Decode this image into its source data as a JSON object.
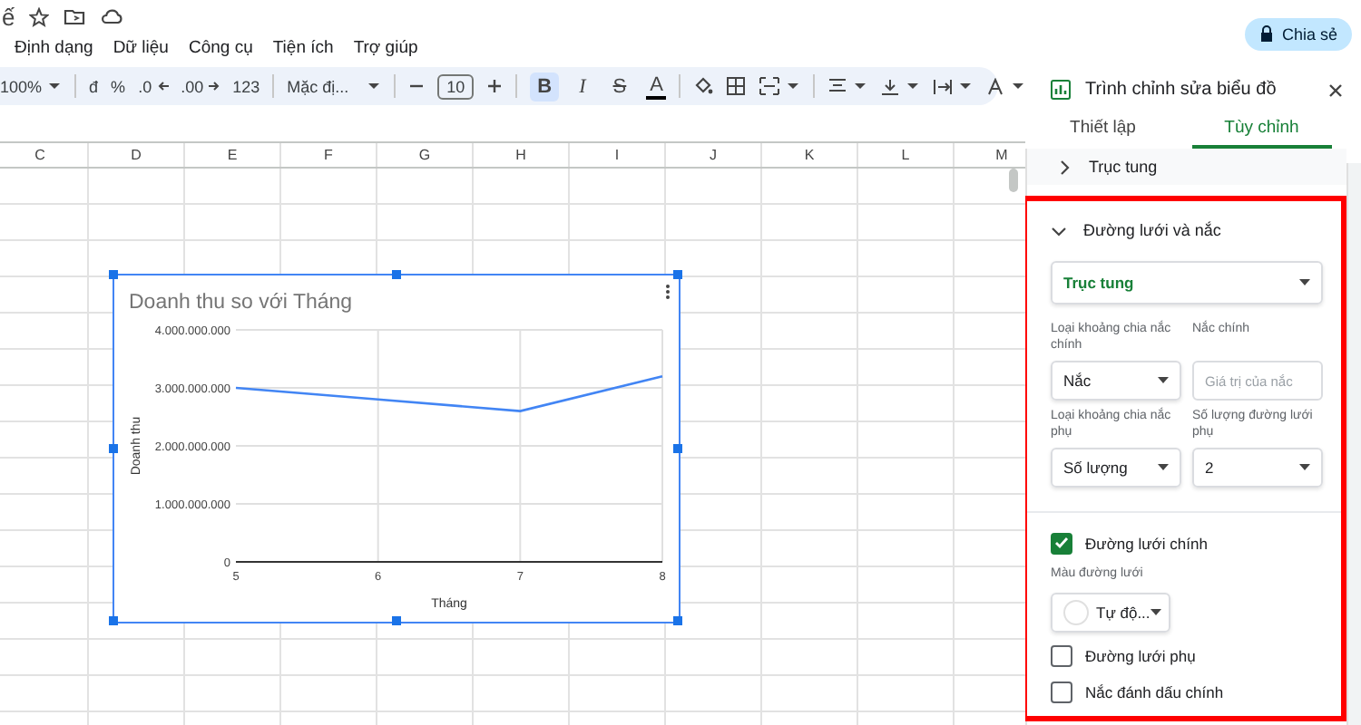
{
  "document": {
    "title_fragment": "ế"
  },
  "menu": [
    "Định dạng",
    "Dữ liệu",
    "Công cụ",
    "Tiện ích",
    "Trợ giúp"
  ],
  "share_button": "Chia sẻ",
  "toolbar": {
    "zoom": "100%",
    "currency": "đ",
    "percent": "%",
    "decrease_decimal": ".0",
    "increase_decimal": ".00",
    "number_format": "123",
    "font": "Mặc đị...",
    "font_size": "10",
    "format_buttons": [
      {
        "kind": "bold",
        "label": "B",
        "selected": true
      },
      {
        "kind": "italic",
        "label": "I",
        "selected": false
      },
      {
        "kind": "strike",
        "label": "S",
        "selected": false
      },
      {
        "kind": "color",
        "label": "A",
        "selected": false
      }
    ]
  },
  "columns": [
    "C",
    "D",
    "E",
    "F",
    "G",
    "H",
    "I",
    "J",
    "K",
    "L",
    "M"
  ],
  "chart": {
    "chart_data": {
      "type": "line",
      "title": "Doanh thu so với Tháng",
      "xlabel": "Tháng",
      "ylabel": "Doanh thu",
      "x": [
        5,
        6,
        7,
        8
      ],
      "series": [
        {
          "color": "#4285f4",
          "values": [
            3000000000,
            2800000000,
            2600000000,
            3200000000
          ]
        }
      ],
      "grid": true,
      "xlim": [
        5,
        8
      ],
      "ylim": [
        0,
        4000000000
      ],
      "xticks": [
        5,
        6,
        7,
        8
      ],
      "yticks": [
        {
          "value": 0,
          "label": "0"
        },
        {
          "value": 1000000000,
          "label": "1.000.000.000"
        },
        {
          "value": 2000000000,
          "label": "2.000.000.000"
        },
        {
          "value": 3000000000,
          "label": "3.000.000.000"
        },
        {
          "value": 4000000000,
          "label": "4.000.000.000"
        }
      ]
    }
  },
  "panel": {
    "title": "Trình chỉnh sửa biểu đồ",
    "tabs": [
      {
        "label": "Thiết lập",
        "selected": false
      },
      {
        "label": "Tùy chỉnh",
        "selected": true
      }
    ],
    "sections": [
      {
        "title": "Trục tung",
        "expanded": false
      },
      {
        "title": "Đường lưới và nắc",
        "expanded": true
      }
    ],
    "axis_select": "Trục tung",
    "fields": [
      {
        "kind": "select",
        "label": "Loại khoảng chia nắc chính",
        "value": "Nắc"
      },
      {
        "kind": "input",
        "label": "Nắc chính",
        "placeholder": "Giá trị của nắc"
      },
      {
        "kind": "select",
        "label": "Loại khoảng chia nắc phụ",
        "value": "Số lượng"
      },
      {
        "kind": "select",
        "label": "Số lượng đường lưới phụ",
        "value": "2"
      }
    ],
    "major_gridlines": {
      "label": "Đường lưới chính",
      "checked": true
    },
    "gridline_color_label": "Màu đường lưới",
    "gridline_color": "Tự độ...",
    "options": [
      {
        "label": "Đường lưới phụ",
        "checked": false
      },
      {
        "label": "Nắc đánh dấu chính",
        "checked": false
      }
    ]
  }
}
